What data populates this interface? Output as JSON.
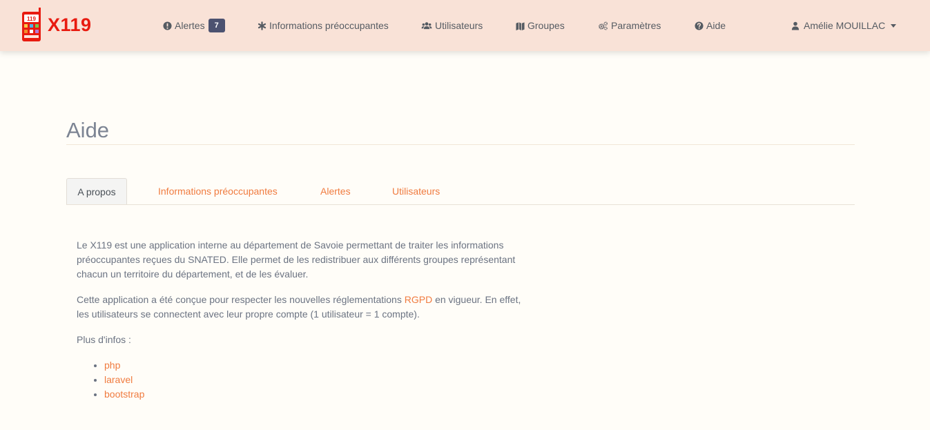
{
  "navbar": {
    "brand_text": "X119",
    "logo_label": "119",
    "items": [
      {
        "label": "Alertes",
        "badge": "7",
        "icon": "exclamation-circle-icon"
      },
      {
        "label": "Informations préoccupantes",
        "icon": "asterisk-icon"
      },
      {
        "label": "Utilisateurs",
        "icon": "users-icon"
      },
      {
        "label": "Groupes",
        "icon": "map-icon"
      },
      {
        "label": "Paramètres",
        "icon": "cogs-icon"
      },
      {
        "label": "Aide",
        "icon": "question-circle-icon"
      }
    ],
    "user": {
      "label": "Amélie MOUILLAC",
      "icon": "user-icon"
    }
  },
  "page": {
    "title": "Aide"
  },
  "tabs": [
    {
      "label": "A propos",
      "active": true
    },
    {
      "label": "Informations préoccupantes",
      "active": false
    },
    {
      "label": "Alertes",
      "active": false
    },
    {
      "label": "Utilisateurs",
      "active": false
    }
  ],
  "content": {
    "paragraph1": "Le X119 est une application interne au département de Savoie permettant de traiter les informations préoccupantes reçues du SNATED. Elle permet de les redistribuer aux différents groupes représentant chacun un territoire du département, et de les évaluer.",
    "paragraph2_before": "Cette application a été conçue pour respecter les nouvelles réglementations ",
    "paragraph2_link": "RGPD",
    "paragraph2_after": " en vigueur. En effet, les utilisateurs se connectent avec leur propre compte (1 utilisateur = 1 compte).",
    "more_info": "Plus d'infos :",
    "links": [
      "php",
      "laravel",
      "bootstrap"
    ]
  },
  "colors": {
    "navbar_bg": "#f9e2d7",
    "accent": "#f07b3f",
    "brand": "#e81b10",
    "badge_bg": "#4c5270"
  }
}
